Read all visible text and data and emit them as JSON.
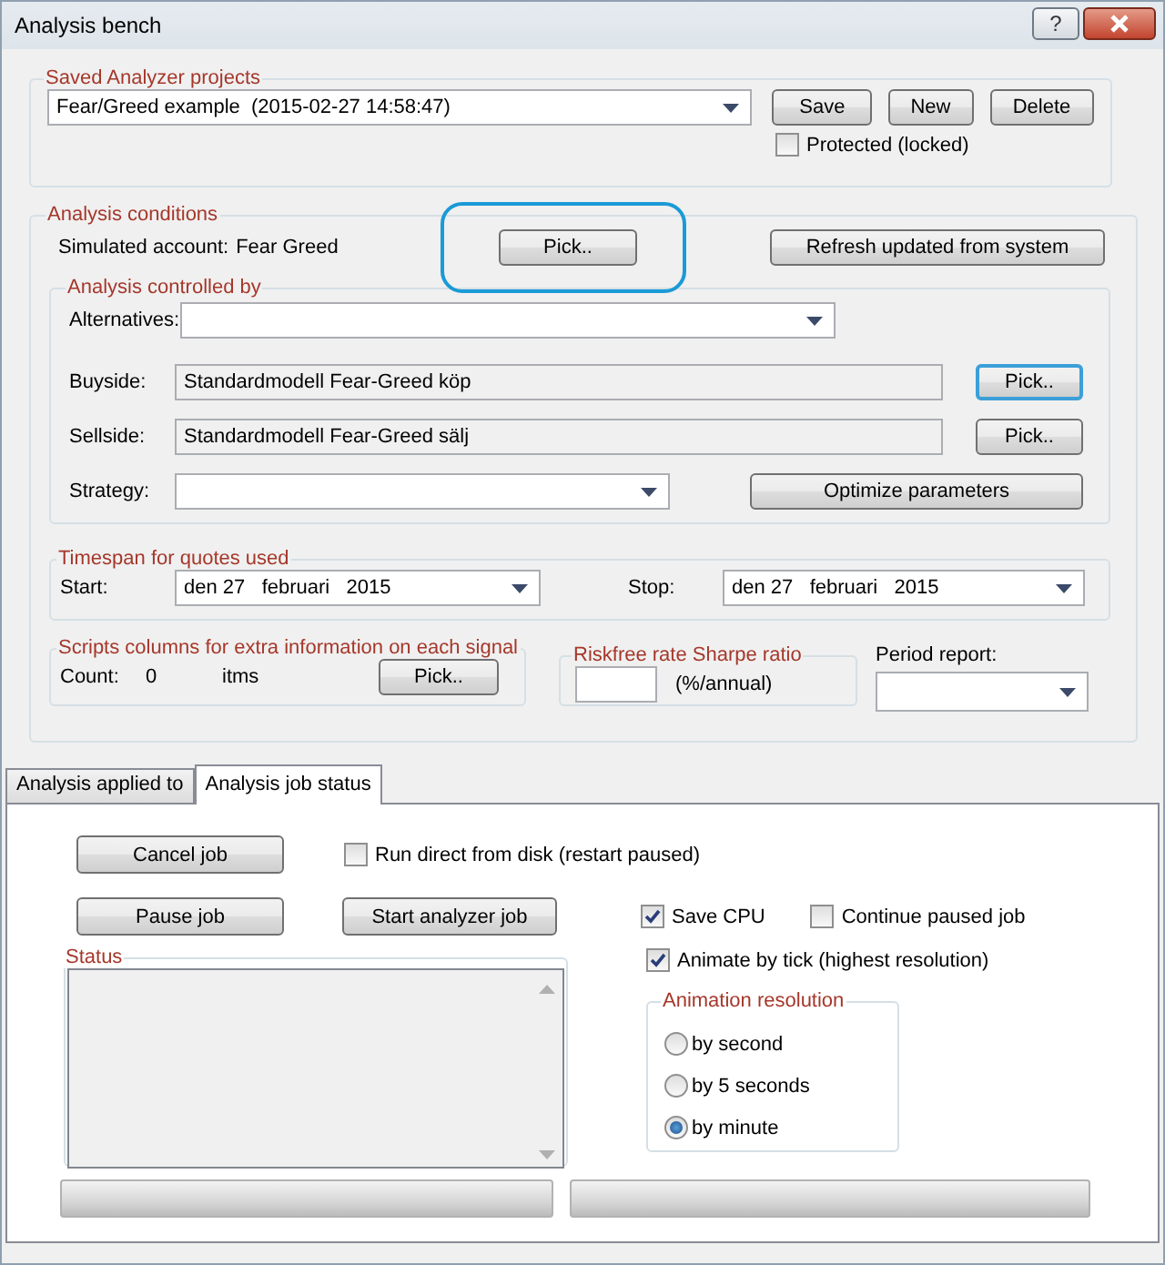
{
  "window": {
    "title": "Analysis bench",
    "help_button": "?"
  },
  "saved_projects": {
    "title": "Saved Analyzer projects",
    "project": "Fear/Greed example  (2015-02-27 14:58:47)",
    "buttons": [
      "Save",
      "New",
      "Delete"
    ],
    "protected": {
      "label": "Protected (locked)",
      "checked": false
    }
  },
  "analysis_conditions": {
    "title": "Analysis conditions",
    "account_label": "Simulated account:",
    "account": "Fear Greed",
    "pick_button": "Pick..",
    "refresh_button": "Refresh updated from system",
    "controlled_by": {
      "title": "Analysis controlled by",
      "alternatives": {
        "label": "Alternatives:"
      },
      "buyside": {
        "label": "Buyside:",
        "value": "Standardmodell Fear-Greed köp",
        "button": {
          "label": "Pick..",
          "focused": true
        }
      },
      "sellside": {
        "label": "Sellside:",
        "value": "Standardmodell Fear-Greed sälj",
        "button": {
          "label": "Pick..",
          "focused": false
        }
      },
      "strategy": {
        "label": "Strategy:"
      },
      "optimize_button": "Optimize parameters"
    },
    "timespan": {
      "title": "Timespan for quotes used",
      "start": {
        "label": "Start:",
        "value": "den 27   februari   2015"
      },
      "stop": {
        "label": "Stop:",
        "value": "den 27   februari   2015"
      }
    },
    "scripts": {
      "title": "Scripts columns for extra information on each signal",
      "count_label": "Count:",
      "count": "0",
      "unit": "itms",
      "pick_button": "Pick.."
    },
    "riskfree": {
      "title": "Riskfree rate Sharpe ratio",
      "unit": "(%/annual)"
    },
    "period_report": {
      "label": "Period report:"
    }
  },
  "tabs": [
    {
      "label": "Analysis applied to",
      "selected": false
    },
    {
      "label": "Analysis job status",
      "selected": true
    }
  ],
  "job": {
    "cancel_button": "Cancel job",
    "run_direct": {
      "label": "Run direct from disk (restart paused)",
      "checked": false
    },
    "pause_button": "Pause job",
    "start_button": "Start analyzer job",
    "save_cpu": {
      "label": "Save CPU",
      "checked": true
    },
    "continue_paused": {
      "label": "Continue paused job",
      "checked": false
    },
    "status": {
      "title": "Status"
    },
    "animate_by_tick": {
      "label": "Animate by tick (highest resolution)",
      "checked": true
    },
    "animation_resolution": {
      "title": "Animation resolution",
      "options": [
        {
          "label": "by second",
          "selected": false
        },
        {
          "label": "by 5 seconds",
          "selected": false
        },
        {
          "label": "by minute",
          "selected": true
        }
      ]
    }
  }
}
